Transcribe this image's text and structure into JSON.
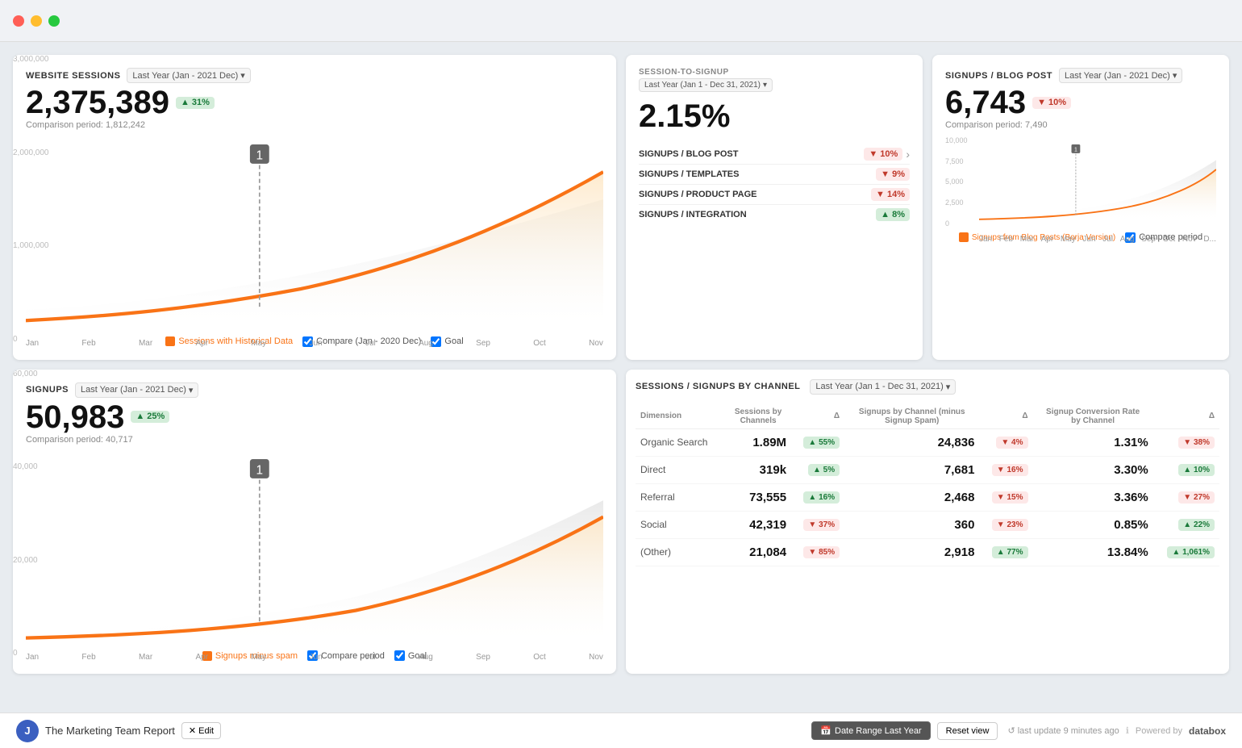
{
  "titleBar": {
    "dots": [
      "red",
      "yellow",
      "green"
    ]
  },
  "topLeft": {
    "title": "WEBSITE SESSIONS",
    "dropdown": "Last Year (Jan - 2021 Dec)",
    "mainValue": "2,375,389",
    "badge": "▲ 31%",
    "badgeType": "green",
    "comparison": "Comparison period: 1,812,242",
    "yAxis": [
      "3,000,000",
      "2,000,000",
      "1,000,000",
      "0"
    ],
    "months": [
      "Jan",
      "Feb",
      "Mar",
      "Apr",
      "May",
      "Jun",
      "Jul",
      "Aug",
      "Sep",
      "Oct",
      "Nov"
    ],
    "legends": [
      {
        "label": "Sessions with Historical Data",
        "color": "#f97316",
        "filled": true
      },
      {
        "label": "Compare (Jan - 2020 Dec)",
        "type": "checkbox"
      },
      {
        "label": "Goal",
        "type": "checkbox"
      }
    ]
  },
  "topMiddle": {
    "conversionLabel": "SESSION-TO-SIGNUP",
    "conversionDropdown": "Last Year (Jan 1 - Dec 31, 2021)",
    "conversionValue": "2.15%",
    "funnelItems": [
      {
        "label": "SIGNUPS / BLOG POST",
        "badge": "▼ 10%",
        "badgeType": "red",
        "arrow": true
      },
      {
        "label": "SIGNUPS / TEMPLATES",
        "badge": "▼ 9%",
        "badgeType": "red"
      },
      {
        "label": "SIGNUPS / PRODUCT PAGE",
        "badge": "▼ 14%",
        "badgeType": "red"
      },
      {
        "label": "SIGNUPS / INTEGRATION",
        "badge": "▲ 8%",
        "badgeType": "green"
      }
    ]
  },
  "topRight": {
    "title": "SIGNUPS / BLOG POST",
    "dropdown": "Last Year (Jan - 2021 Dec)",
    "mainValue": "6,743",
    "badge": "▼ 10%",
    "badgeType": "red",
    "comparison": "Comparison period: 7,490",
    "yAxis": [
      "10,000",
      "7,500",
      "5,000",
      "2,500",
      "0"
    ],
    "months": [
      "Jan",
      "Feb",
      "Mar",
      "Apr",
      "May",
      "Jun",
      "Jul",
      "Aug",
      "Sep",
      "Oct",
      "Nov",
      "D..."
    ],
    "legends": [
      {
        "label": "Signups from Blog Posts (Borja Version)",
        "color": "#f97316",
        "filled": true
      },
      {
        "label": "Compare period",
        "type": "checkbox"
      }
    ]
  },
  "bottomLeft": {
    "title": "SIGNUPS",
    "dropdown": "Last Year (Jan - 2021 Dec)",
    "mainValue": "50,983",
    "badge": "▲ 25%",
    "badgeType": "green",
    "comparison": "Comparison period: 40,717",
    "yAxis": [
      "60,000",
      "40,000",
      "20,000",
      "0"
    ],
    "months": [
      "Jan",
      "Feb",
      "Mar",
      "Apr",
      "May",
      "Jun",
      "Jul",
      "Aug",
      "Sep",
      "Oct",
      "Nov"
    ],
    "legends": [
      {
        "label": "Signups minus spam",
        "color": "#f97316",
        "filled": true
      },
      {
        "label": "Compare period",
        "type": "checkbox"
      },
      {
        "label": "Goal",
        "type": "checkbox"
      }
    ]
  },
  "bottomRight": {
    "title": "SESSIONS / SIGNUPS BY CHANNEL",
    "dropdown": "Last Year (Jan 1 - Dec 31, 2021)",
    "columns": {
      "dimension": "Dimension",
      "sessions": "Sessions by Channels",
      "sessionsDelta": "Δ",
      "signups": "Signups by Channel (minus Signup Spam)",
      "signupsDelta": "Δ",
      "convRate": "Signup Conversion Rate by Channel",
      "convDelta": "Δ"
    },
    "rows": [
      {
        "dimension": "Organic Search",
        "sessions": "1.89M",
        "sessionsDelta": "▲ 55%",
        "sessionsDeltaType": "green",
        "signups": "24,836",
        "signupsDelta": "▼ 4%",
        "signupsDeltaType": "red",
        "convRate": "1.31%",
        "convDelta": "▼ 38%",
        "convDeltaType": "red"
      },
      {
        "dimension": "Direct",
        "sessions": "319k",
        "sessionsDelta": "▲ 5%",
        "sessionsDeltaType": "green",
        "signups": "7,681",
        "signupsDelta": "▼ 16%",
        "signupsDeltaType": "red",
        "convRate": "3.30%",
        "convDelta": "▲ 10%",
        "convDeltaType": "green"
      },
      {
        "dimension": "Referral",
        "sessions": "73,555",
        "sessionsDelta": "▲ 16%",
        "sessionsDeltaType": "green",
        "signups": "2,468",
        "signupsDelta": "▼ 15%",
        "signupsDeltaType": "red",
        "convRate": "3.36%",
        "convDelta": "▼ 27%",
        "convDeltaType": "red"
      },
      {
        "dimension": "Social",
        "sessions": "42,319",
        "sessionsDelta": "▼ 37%",
        "sessionsDeltaType": "red",
        "signups": "360",
        "signupsDelta": "▼ 23%",
        "signupsDeltaType": "red",
        "convRate": "0.85%",
        "convDelta": "▲ 22%",
        "convDeltaType": "green"
      },
      {
        "dimension": "(Other)",
        "sessions": "21,084",
        "sessionsDelta": "▼ 85%",
        "sessionsDeltaType": "red",
        "signups": "2,918",
        "signupsDelta": "▲ 77%",
        "signupsDeltaType": "green",
        "convRate": "13.84%",
        "convDelta": "▲ 1,061%",
        "convDeltaType": "green"
      }
    ]
  },
  "bottomBar": {
    "reportName": "The Marketing Team Report",
    "editLabel": "✕ Edit",
    "dateRangeLabel": "Date Range  Last Year",
    "resetLabel": "Reset view",
    "lastUpdate": "last update 9 minutes ago",
    "poweredBy": "Powered by",
    "databoxLogo": "databox"
  }
}
